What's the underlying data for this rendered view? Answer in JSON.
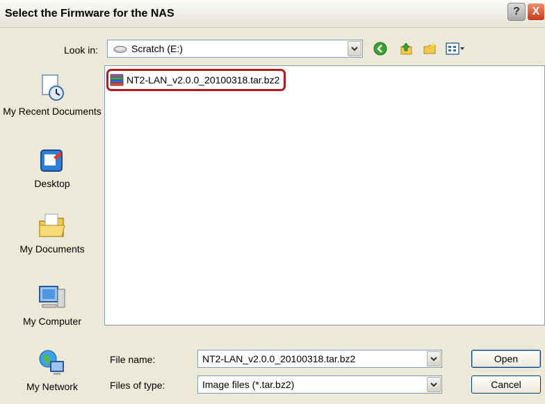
{
  "window": {
    "title": "Select the Firmware for the NAS",
    "help_label": "?",
    "close_label": "X"
  },
  "lookin": {
    "label": "Look in:",
    "value": "Scratch (E:)"
  },
  "toolbar": {
    "icons": [
      "back-icon",
      "up-folder-icon",
      "new-folder-icon",
      "view-menu-icon"
    ]
  },
  "places": [
    {
      "label": "My Recent Documents",
      "icon": "recent-documents-icon"
    },
    {
      "label": "Desktop",
      "icon": "desktop-icon"
    },
    {
      "label": "My Documents",
      "icon": "my-documents-icon"
    },
    {
      "label": "My Computer",
      "icon": "my-computer-icon"
    },
    {
      "label": "My Network",
      "icon": "my-network-icon"
    }
  ],
  "files": [
    {
      "name": "NT2-LAN_v2.0.0_20100318.tar.bz2",
      "icon": "archive-icon",
      "highlighted": true
    }
  ],
  "filename": {
    "label": "File name:",
    "value": "NT2-LAN_v2.0.0_20100318.tar.bz2"
  },
  "filetype": {
    "label": "Files of type:",
    "value": "Image files (*.tar.bz2)"
  },
  "buttons": {
    "open": "Open",
    "cancel": "Cancel"
  },
  "colors": {
    "dialog_bg": "#ece9d8",
    "highlight_border": "#b51a1a",
    "close_red": "#c83b14"
  }
}
